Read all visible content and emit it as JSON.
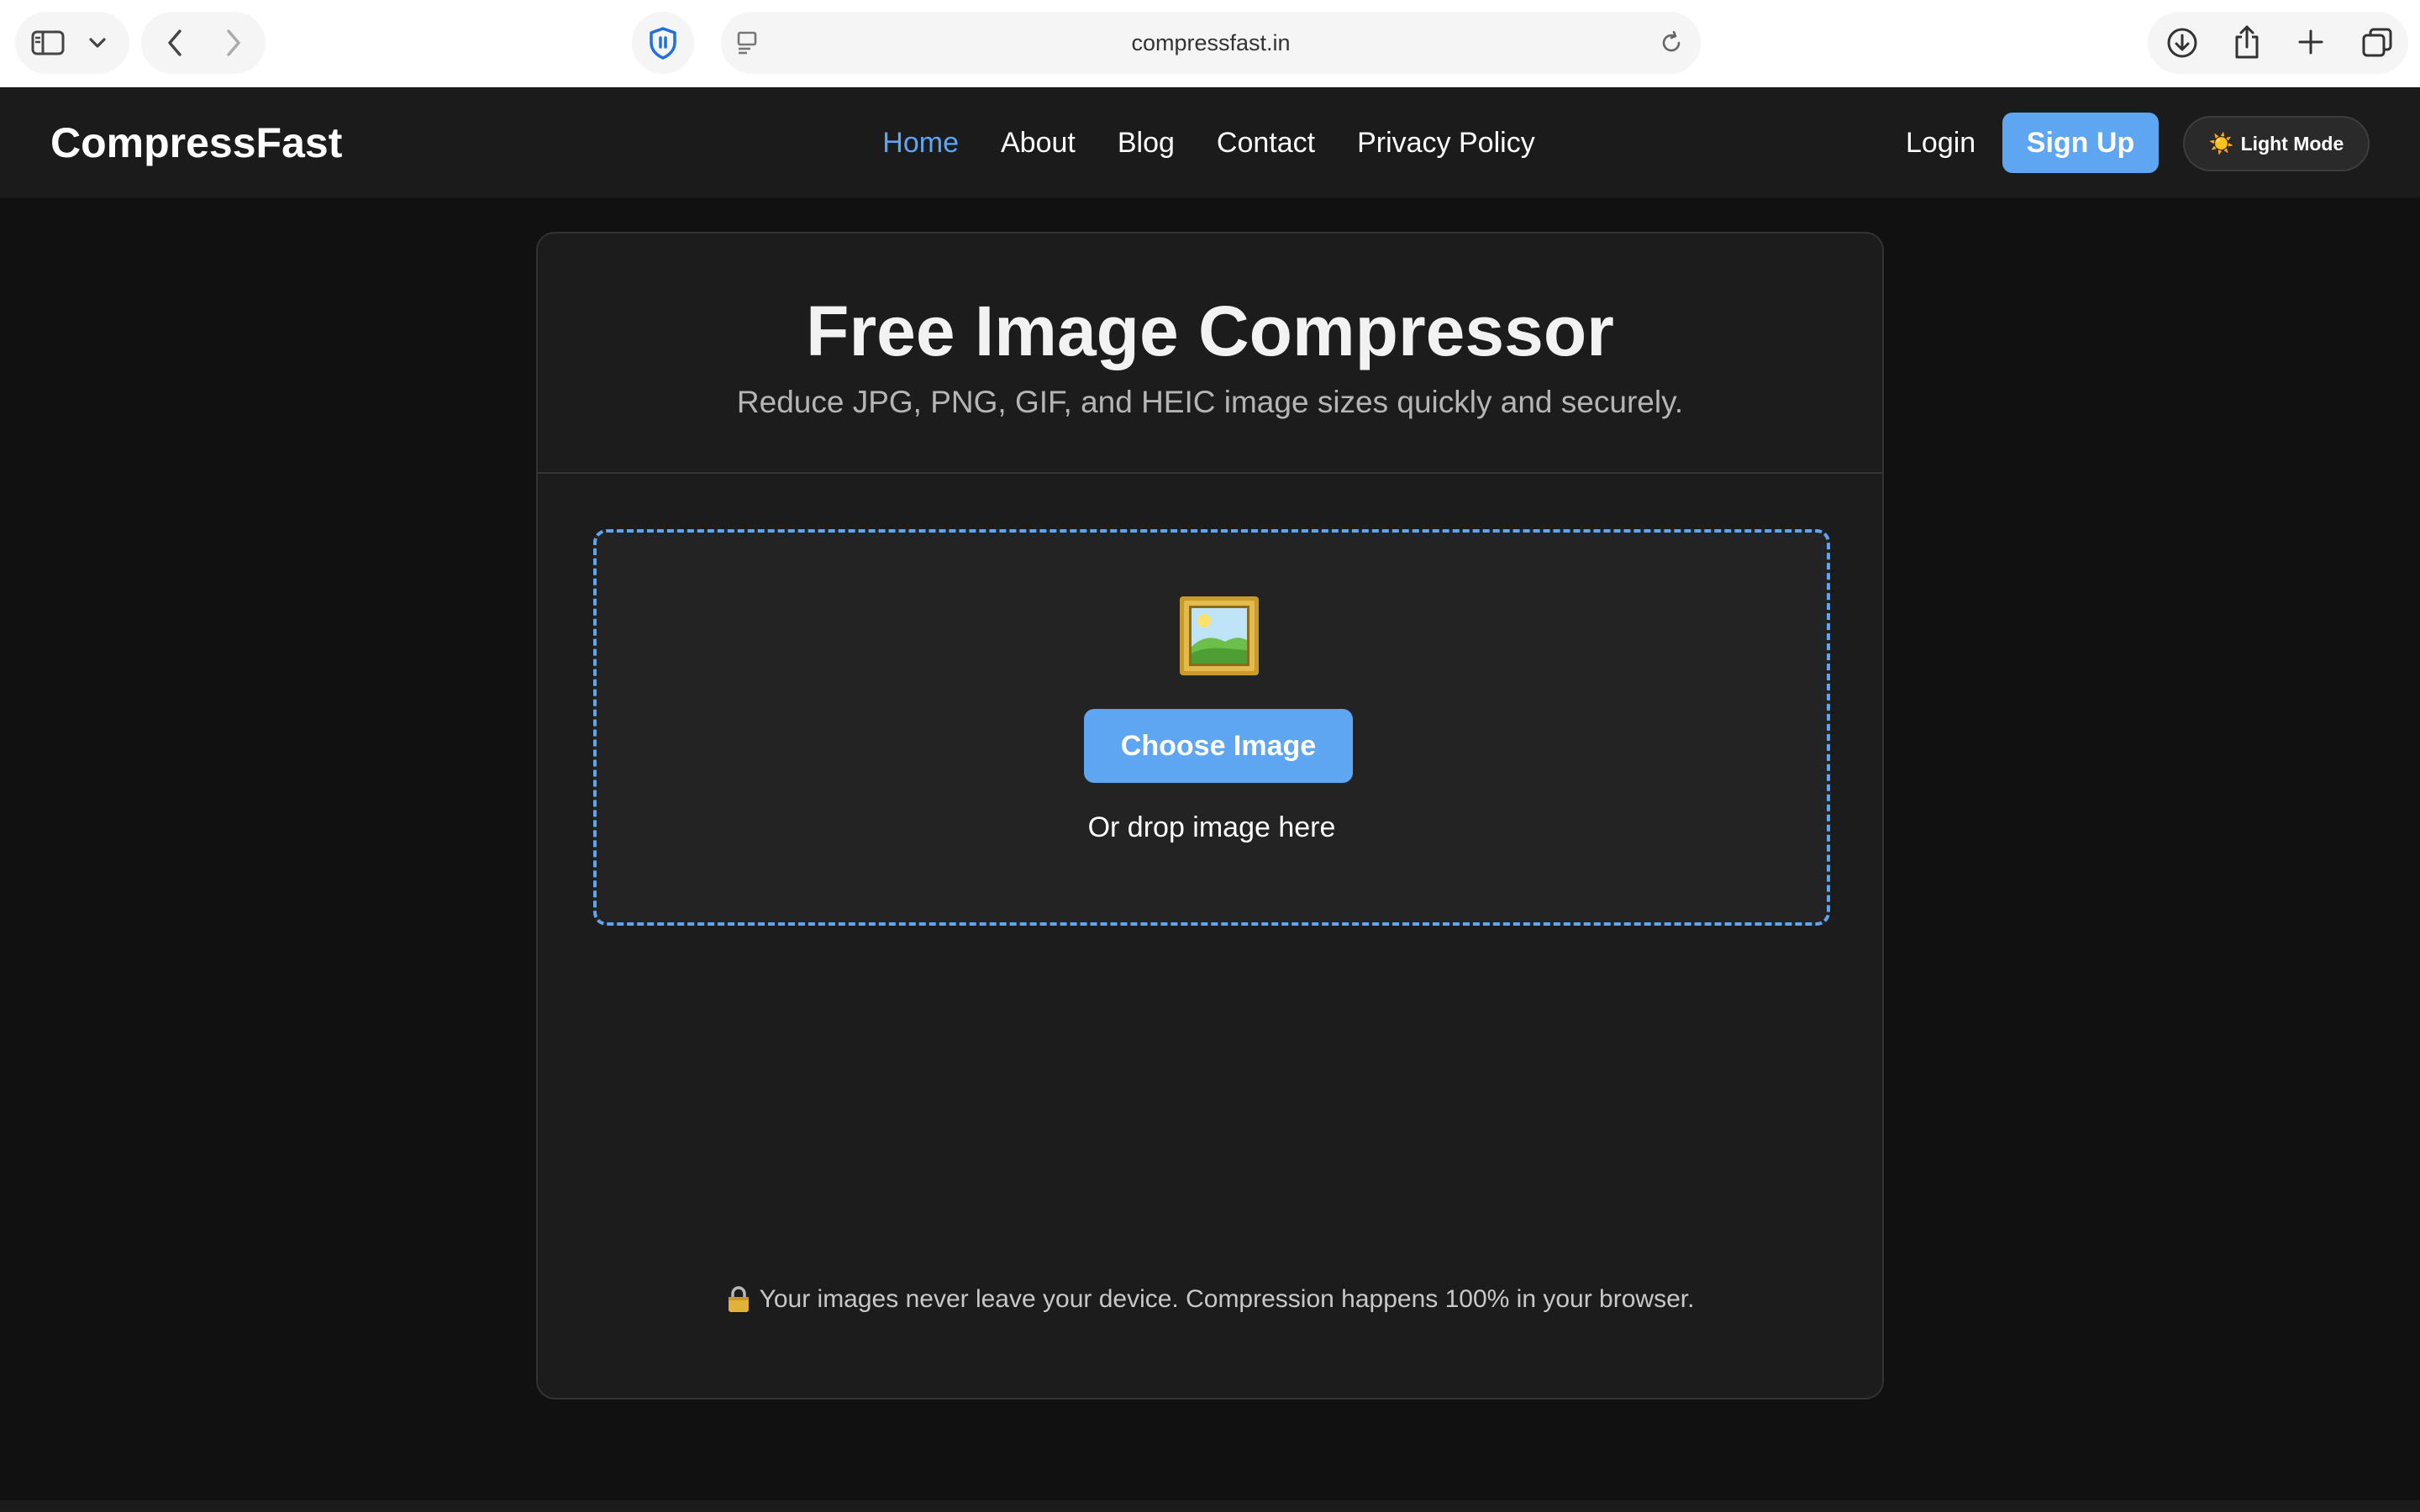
{
  "browser": {
    "url": "compressfast.in",
    "icons": [
      "sidebar-icon",
      "chevron-down-icon",
      "back-icon",
      "forward-icon",
      "shield-icon",
      "reader-icon",
      "reload-icon",
      "download-icon",
      "share-icon",
      "plus-icon",
      "tabs-icon"
    ]
  },
  "nav": {
    "logo": "CompressFast",
    "links": [
      "Home",
      "About",
      "Blog",
      "Contact",
      "Privacy Policy"
    ],
    "active": "Home",
    "login": "Login",
    "signup": "Sign Up",
    "theme_icon": "☀️",
    "theme_label": "Light Mode"
  },
  "main": {
    "title": "Free Image Compressor",
    "subtitle": "Reduce JPG, PNG, GIF, and HEIC image sizes quickly and securely.",
    "dropzone": {
      "icon": "framed-picture-icon",
      "button": "Choose Image",
      "hint": "Or drop image here"
    },
    "privacy_note": "Your images never leave your device. Compression happens 100% in your browser."
  },
  "colors": {
    "accent": "#5ea6f1",
    "background": "#111111",
    "card": "#1c1c1c",
    "navbar": "#1b1b1b"
  }
}
